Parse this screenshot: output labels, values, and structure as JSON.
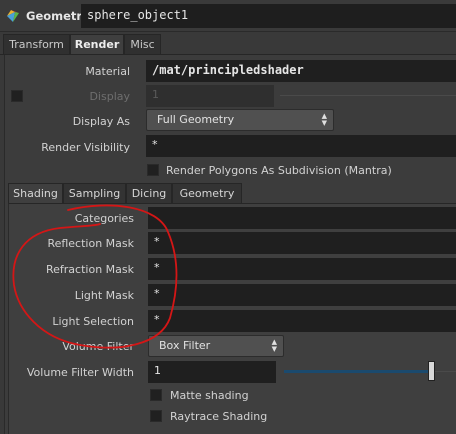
{
  "header": {
    "node_type": "Geometry",
    "object_name": "sphere_object1"
  },
  "tabs": [
    {
      "label": "Transform",
      "active": false
    },
    {
      "label": "Render",
      "active": true
    },
    {
      "label": "Misc",
      "active": false
    }
  ],
  "render": {
    "material_label": "Material",
    "material_value": "/mat/principledshader",
    "display_label": "Display",
    "display_value": "1",
    "display_as_label": "Display As",
    "display_as_value": "Full Geometry",
    "render_visibility_label": "Render Visibility",
    "render_visibility_value": "*",
    "subdivision_label": "Render Polygons As Subdivision (Mantra)"
  },
  "subtabs": [
    {
      "label": "Shading",
      "active": true
    },
    {
      "label": "Sampling",
      "active": false
    },
    {
      "label": "Dicing",
      "active": false
    },
    {
      "label": "Geometry",
      "active": false
    }
  ],
  "shading": {
    "categories_label": "Categories",
    "categories_value": "",
    "reflection_mask_label": "Reflection Mask",
    "reflection_mask_value": "*",
    "refraction_mask_label": "Refraction Mask",
    "refraction_mask_value": "*",
    "light_mask_label": "Light Mask",
    "light_mask_value": "*",
    "light_selection_label": "Light Selection",
    "light_selection_value": "*",
    "volume_filter_label": "Volume Filter",
    "volume_filter_value": "Box Filter",
    "volume_filter_width_label": "Volume Filter Width",
    "volume_filter_width_value": "1",
    "matte_shading_label": "Matte shading",
    "raytrace_shading_label": "Raytrace Shading"
  },
  "colors": {
    "annotation": "#d41616",
    "slider": "#1b4a6e"
  },
  "icons": [
    "geometry-node-icon",
    "display-checkbox",
    "dropdown-arrows-icon",
    "slider-handle"
  ]
}
